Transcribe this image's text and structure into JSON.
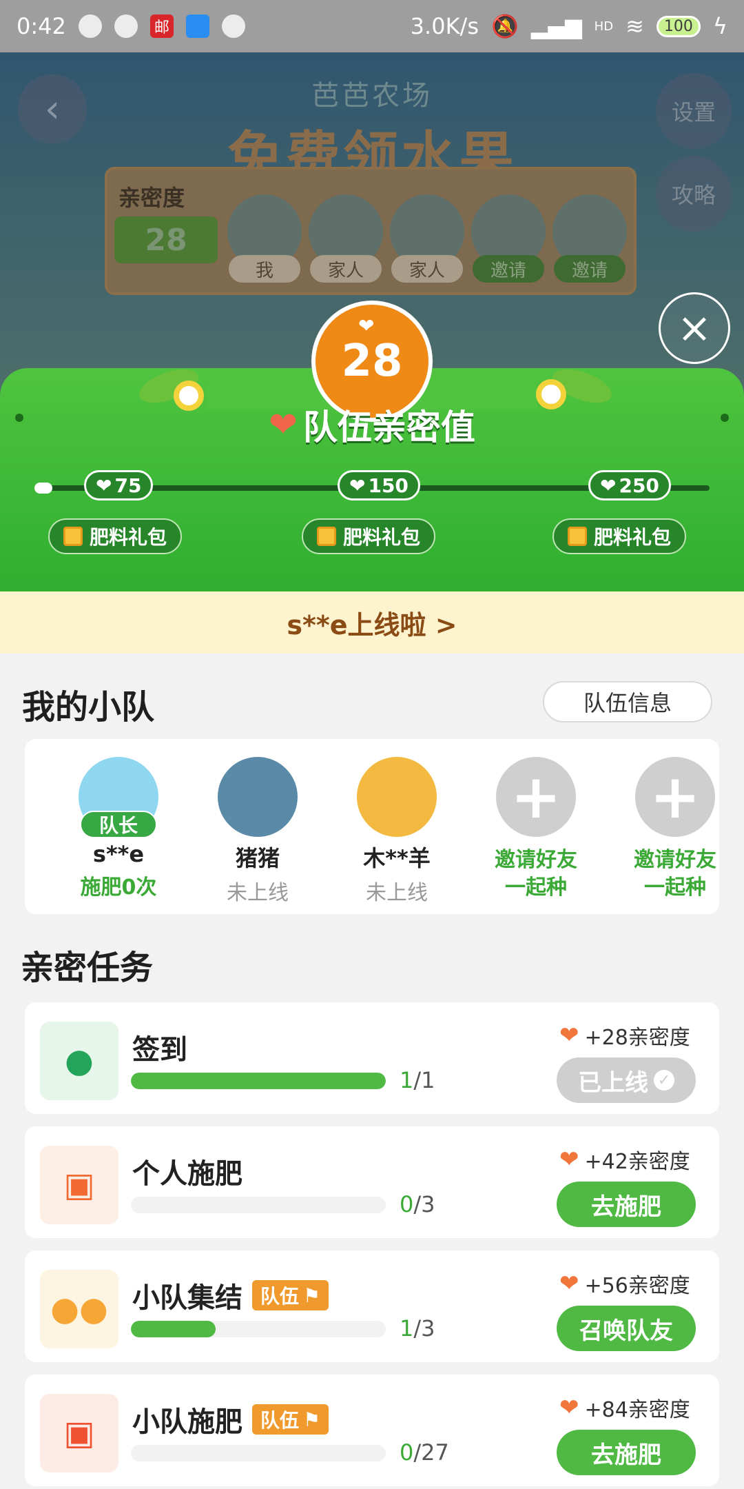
{
  "status_bar": {
    "time": "0:42",
    "red_app_label": "邮",
    "net_speed": "3.0K/s",
    "signal_text": "HD",
    "battery": "100"
  },
  "background": {
    "small_title": "芭芭农场",
    "big_title": "免费领水果",
    "back_icon": "‹",
    "side_buttons": [
      "设置",
      "攻略"
    ],
    "intimacy_label": "亲密度",
    "intimacy_score": "28",
    "member_tags": [
      "我",
      "家人",
      "家人",
      "邀请",
      "邀请"
    ]
  },
  "panel": {
    "score": "28",
    "title": "队伍亲密值",
    "progress": 0.0,
    "milestones": [
      "75",
      "150",
      "250"
    ],
    "gifts": [
      "肥料礼包",
      "肥料礼包",
      "肥料礼包"
    ],
    "close_icon": "×"
  },
  "notice": {
    "text": "s**e上线啦 >"
  },
  "my_team": {
    "title": "我的小队",
    "info_button": "队伍信息",
    "members": [
      {
        "name": "s**e",
        "status": "施肥0次",
        "badge": "队长"
      },
      {
        "name": "猪猪",
        "status": "未上线"
      },
      {
        "name": "木**羊",
        "status": "未上线"
      },
      {
        "invite_line1": "邀请好友",
        "invite_line2": "一起种"
      },
      {
        "invite_line1": "邀请好友",
        "invite_line2": "一起种"
      }
    ]
  },
  "tasks": {
    "title": "亲密任务",
    "team_tag": "队伍",
    "items": [
      {
        "name": "签到",
        "done": "1",
        "total": "/1",
        "fraction": 1.0,
        "reward": "+28亲密度",
        "action": "已上线",
        "icon": "person-icon"
      },
      {
        "name": "个人施肥",
        "done": "0",
        "total": "/3",
        "fraction": 0.0,
        "reward": "+42亲密度",
        "action": "去施肥",
        "icon": "fertilizer-bag-icon"
      },
      {
        "name": "小队集结",
        "done": "1",
        "total": "/3",
        "fraction": 0.333,
        "reward": "+56亲密度",
        "action": "召唤队友",
        "icon": "group-icon"
      },
      {
        "name": "小队施肥",
        "done": "0",
        "total": "/27",
        "fraction": 0.0,
        "reward": "+84亲密度",
        "action": "去施肥",
        "icon": "team-fertilizer-icon"
      }
    ]
  },
  "colors": {
    "primary_green": "#4fb944",
    "orange": "#f08a17",
    "notice_text": "#8a4b14"
  }
}
